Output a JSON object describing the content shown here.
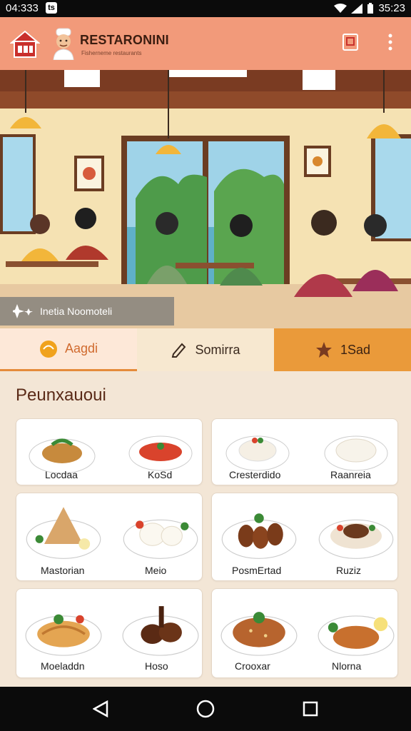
{
  "status_bar": {
    "time": "04:333",
    "notification_badge": "ts",
    "clock_right": "35:23"
  },
  "app_bar": {
    "title": "RESTARONINI",
    "subtitle": "Fisherneme restaurants"
  },
  "hero": {
    "caption": "Inetia Noomoteli"
  },
  "tabs": [
    {
      "label": "Aagdi",
      "icon": "circle-coin-icon"
    },
    {
      "label": "Somirra",
      "icon": "pencil-tag-icon"
    },
    {
      "label": "1Sad",
      "icon": "leaf-flower-icon"
    }
  ],
  "section": {
    "title": "Peunxauoui"
  },
  "menu_cards": [
    {
      "left": "Locdaa",
      "right": "KoSd"
    },
    {
      "left": "Cresterdido",
      "right": "Raanreia"
    },
    {
      "left": "Mastorian",
      "right": "Meio"
    },
    {
      "left": "PosmErtad",
      "right": "Ruziz"
    },
    {
      "left": "Moeladdn",
      "right": "Hoso"
    },
    {
      "left": "Crooxar",
      "right": "Nlorna"
    }
  ],
  "colors": {
    "app_bar": "#f29a7a",
    "tab_active": "#fde8d8",
    "tab_accent": "#ea9a3a",
    "background": "#f3e6d6"
  }
}
